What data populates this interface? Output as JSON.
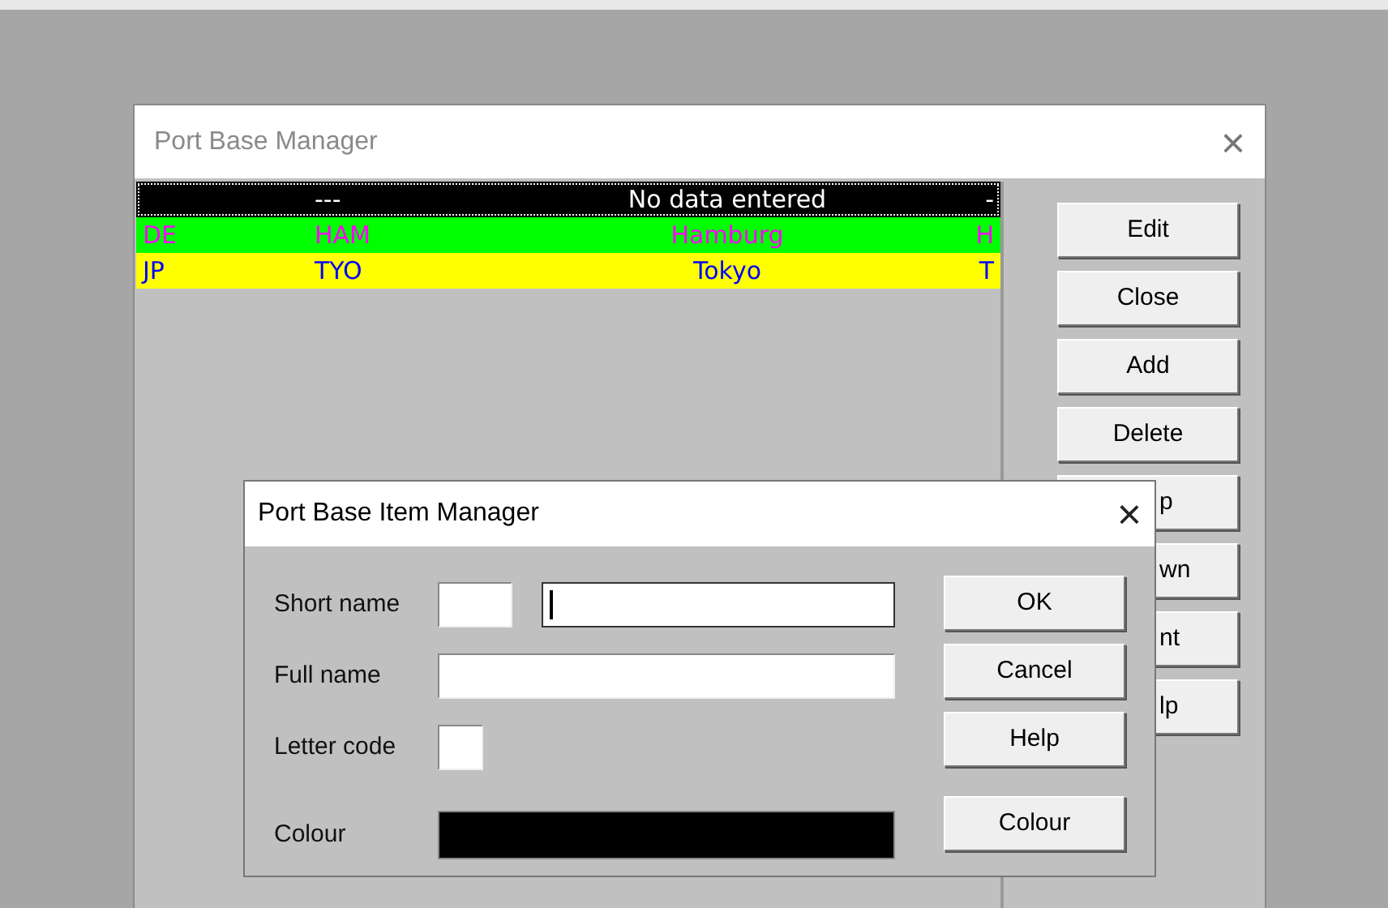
{
  "main_window": {
    "title": "Port Base Manager",
    "close": "×",
    "list": [
      {
        "short": "---",
        "name": "No data entered",
        "letter": "-",
        "color": "#000000",
        "ink": {
          "color": "#ffffff"
        },
        "selected": true
      },
      {
        "code": "DE",
        "short": "HAM",
        "name": "Hamburg",
        "letter": "H",
        "color": "#00ff00",
        "ink": {
          "color": "#ff00ff"
        },
        "selected": false
      },
      {
        "code": "JP",
        "short": "TYO",
        "name": "Tokyo",
        "letter": "T",
        "color": "#ffff00",
        "ink": {
          "color": "#0000ff"
        },
        "selected": false
      }
    ],
    "buttons": [
      {
        "label": "Edit",
        "kind": "full"
      },
      {
        "label": "Close",
        "kind": "full"
      },
      {
        "label": "Add",
        "kind": "full"
      },
      {
        "label": "Delete",
        "kind": "full"
      },
      {
        "label": "p",
        "kind": "partial"
      },
      {
        "label": "wn",
        "kind": "partial"
      },
      {
        "label": "nt",
        "kind": "partial"
      },
      {
        "label": "lp",
        "kind": "partial"
      }
    ]
  },
  "dialog": {
    "title": "Port Base Item Manager",
    "close": "×",
    "fields": [
      {
        "label": "Short name",
        "kind": "pair",
        "focused": true
      },
      {
        "label": "Full name",
        "kind": "wide",
        "focused": false
      },
      {
        "label": "Letter code",
        "kind": "tiny",
        "focused": false
      },
      {
        "label": "Colour",
        "kind": "swatch",
        "color": "#000000"
      }
    ],
    "buttons": [
      "OK",
      "Cancel",
      "Help",
      "Colour"
    ]
  }
}
